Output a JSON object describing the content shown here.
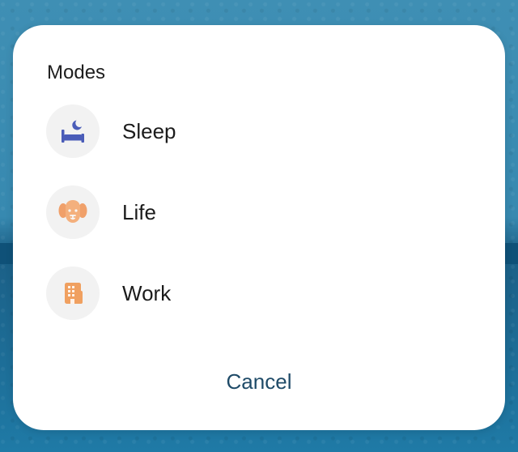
{
  "dialog": {
    "title": "Modes",
    "items": [
      {
        "label": "Sleep",
        "icon": "bed-moon-icon",
        "color": "#4a5cb8"
      },
      {
        "label": "Life",
        "icon": "dog-face-icon",
        "color": "#f0a06a"
      },
      {
        "label": "Work",
        "icon": "building-icon",
        "color": "#f0a060"
      }
    ],
    "cancel_label": "Cancel"
  },
  "colors": {
    "background_blue": "#2f87b3",
    "dialog_background": "#ffffff",
    "icon_background": "#f2f2f2",
    "cancel_text": "#1f4b68"
  }
}
